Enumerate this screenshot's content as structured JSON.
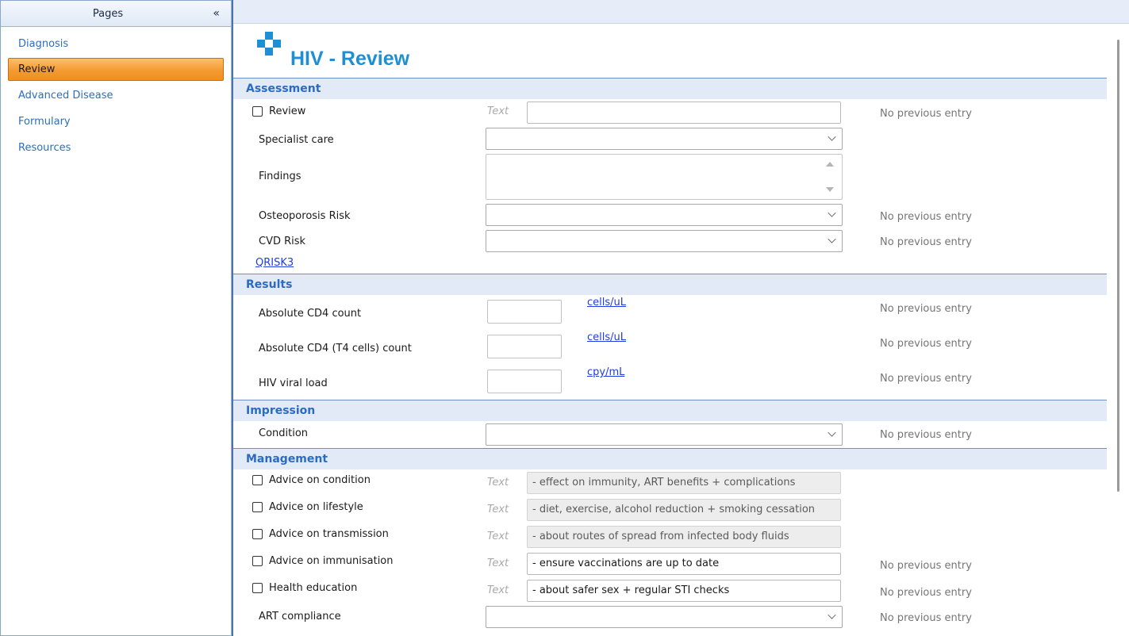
{
  "sidebar": {
    "title": "Pages",
    "collapse_glyph": "«",
    "items": [
      {
        "label": "Diagnosis",
        "active": false
      },
      {
        "label": "Review",
        "active": true
      },
      {
        "label": "Advanced Disease",
        "active": false
      },
      {
        "label": "Formulary",
        "active": false
      },
      {
        "label": "Resources",
        "active": false
      }
    ]
  },
  "page": {
    "title": "HIV - Review",
    "logo_icon": "medical-cross-icon",
    "accent_color": "#1e8fd4"
  },
  "hint_text": "Text",
  "no_previous": "No previous entry",
  "assessment": {
    "header": "Assessment",
    "review_label": "Review",
    "review_value": "",
    "specialist_label": "Specialist care",
    "findings_label": "Findings",
    "osteoporosis_label": "Osteoporosis Risk",
    "cvd_label": "CVD Risk",
    "qrisk_link": "QRISK3"
  },
  "results": {
    "header": "Results",
    "rows": [
      {
        "label": "Absolute CD4 count",
        "unit": "cells/uL",
        "value": ""
      },
      {
        "label": "Absolute CD4 (T4 cells) count",
        "unit": "cells/uL",
        "value": ""
      },
      {
        "label": "HIV viral load",
        "unit": "cpy/mL",
        "value": ""
      }
    ]
  },
  "impression": {
    "header": "Impression",
    "condition_label": "Condition"
  },
  "management": {
    "header": "Management",
    "items": [
      {
        "label": "Advice on condition",
        "value": "- effect on immunity, ART benefits + complications"
      },
      {
        "label": "Advice on lifestyle",
        "value": "- diet, exercise, alcohol reduction + smoking cessation"
      },
      {
        "label": "Advice on transmission",
        "value": "- about routes of spread from infected body fluids"
      },
      {
        "label": "Advice on immunisation",
        "value": "- ensure vaccinations are up to date"
      },
      {
        "label": "Health education",
        "value": "- about safer sex + regular STI checks"
      }
    ],
    "art_label": "ART compliance"
  }
}
